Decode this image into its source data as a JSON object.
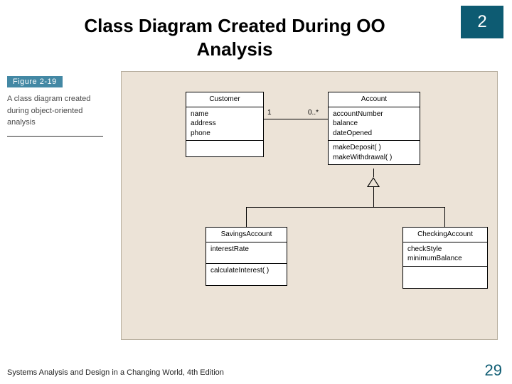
{
  "chapter": "2",
  "title": "Class Diagram Created During OO Analysis",
  "figure": {
    "label": "Figure 2-19",
    "caption": "A class diagram created during object-oriented analysis"
  },
  "classes": {
    "customer": {
      "name": "Customer",
      "attrs": "name\naddress\nphone",
      "ops": ""
    },
    "account": {
      "name": "Account",
      "attrs": "accountNumber\nbalance\ndateOpened",
      "ops": "makeDeposit( )\nmakeWithdrawal( )"
    },
    "savings": {
      "name": "SavingsAccount",
      "attrs": "interestRate",
      "ops": "calculateInterest( )"
    },
    "checking": {
      "name": "CheckingAccount",
      "attrs": "checkStyle\nminimumBalance",
      "ops": ""
    }
  },
  "association": {
    "left_mult": "1",
    "right_mult": "0..*"
  },
  "footer": "Systems Analysis and Design in a Changing World, 4th Edition",
  "page": "29"
}
